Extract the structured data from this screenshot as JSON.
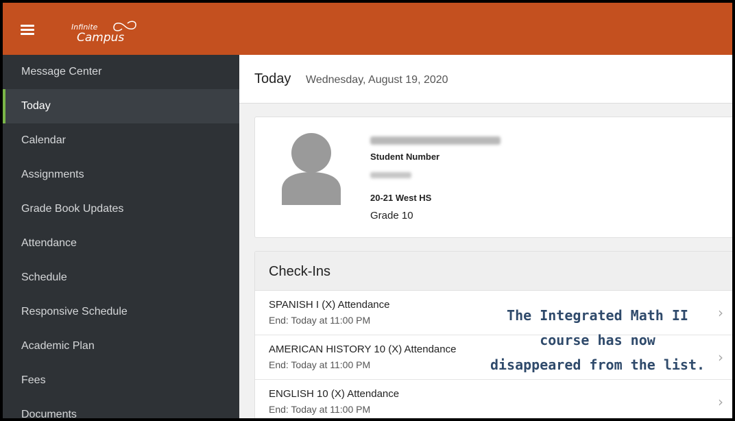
{
  "header": {
    "logo_line1": "Infinite",
    "logo_line2": "Campus",
    "brand_color": "#c4501f",
    "menu_icon": "hamburger-menu-icon"
  },
  "sidebar": {
    "items": [
      {
        "label": "Message Center"
      },
      {
        "label": "Today"
      },
      {
        "label": "Calendar"
      },
      {
        "label": "Assignments"
      },
      {
        "label": "Grade Book Updates"
      },
      {
        "label": "Attendance"
      },
      {
        "label": "Schedule"
      },
      {
        "label": "Responsive Schedule"
      },
      {
        "label": "Academic Plan"
      },
      {
        "label": "Fees"
      },
      {
        "label": "Documents"
      }
    ],
    "active_index": 1,
    "active_accent": "#7ab648"
  },
  "main": {
    "title": "Today",
    "date": "Wednesday, August 19, 2020",
    "profile": {
      "student_number_label": "Student Number",
      "school": "20-21 West HS",
      "grade": "Grade 10"
    },
    "checkins": {
      "title": "Check-Ins",
      "rows": [
        {
          "name": "SPANISH I (X) Attendance",
          "end": "End: Today at 11:00 PM"
        },
        {
          "name": "AMERICAN HISTORY 10 (X) Attendance",
          "end": "End: Today at 11:00 PM"
        },
        {
          "name": "ENGLISH 10 (X) Attendance",
          "end": "End: Today at 11:00 PM"
        }
      ]
    }
  },
  "annotation": {
    "line1": "The Integrated Math II",
    "line2": "course has now",
    "line3": "disappeared from the list."
  }
}
